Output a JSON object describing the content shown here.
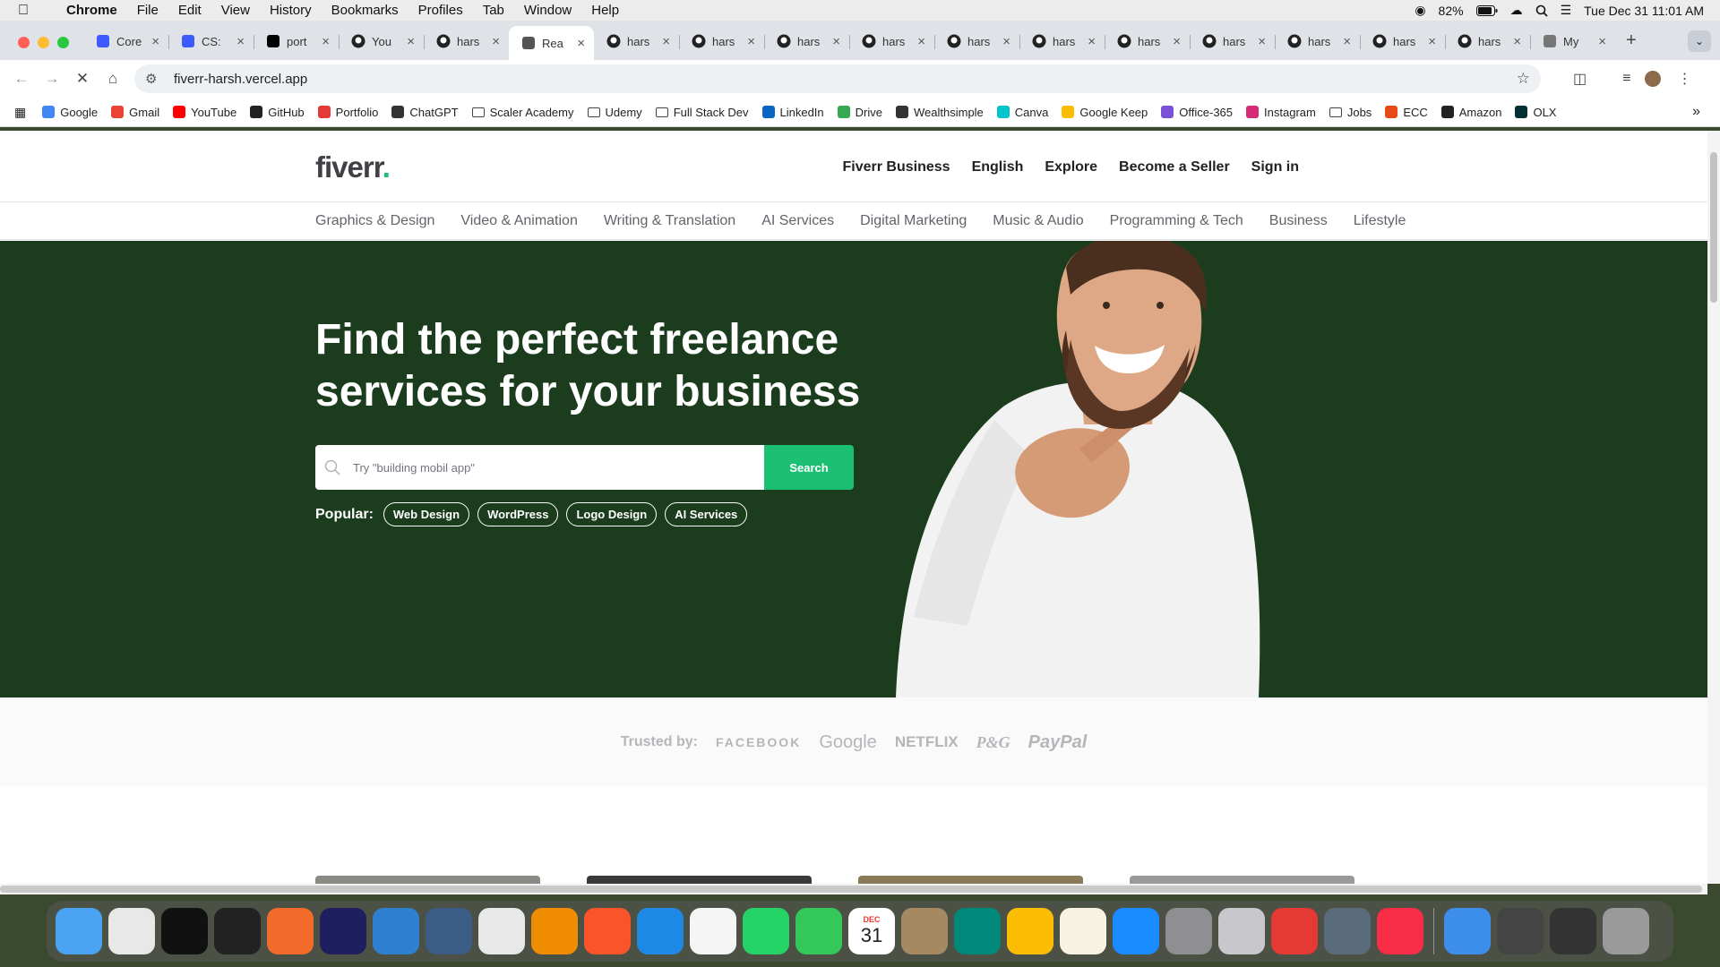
{
  "menubar": {
    "app_name": "Chrome",
    "items": [
      "File",
      "Edit",
      "View",
      "History",
      "Bookmarks",
      "Profiles",
      "Tab",
      "Window",
      "Help"
    ],
    "battery": "82%",
    "datetime": "Tue Dec 31  11:01 AM"
  },
  "tabs": [
    {
      "title": "Core",
      "icon": "cortex-icon",
      "color": "#3d5afe"
    },
    {
      "title": "CS:",
      "icon": "cortex-icon",
      "color": "#3d5afe"
    },
    {
      "title": "port",
      "icon": "vercel-icon",
      "color": "#000000"
    },
    {
      "title": "You",
      "icon": "github-icon",
      "color": "#222222"
    },
    {
      "title": "hars",
      "icon": "github-icon",
      "color": "#222222"
    },
    {
      "title": "Rea",
      "icon": "react-icon",
      "color": "#555555"
    },
    {
      "title": "hars",
      "icon": "github-icon",
      "color": "#222222"
    },
    {
      "title": "hars",
      "icon": "github-icon",
      "color": "#222222"
    },
    {
      "title": "hars",
      "icon": "github-icon",
      "color": "#222222"
    },
    {
      "title": "hars",
      "icon": "github-icon",
      "color": "#222222"
    },
    {
      "title": "hars",
      "icon": "github-icon",
      "color": "#222222"
    },
    {
      "title": "hars",
      "icon": "github-icon",
      "color": "#222222"
    },
    {
      "title": "hars",
      "icon": "github-icon",
      "color": "#222222"
    },
    {
      "title": "hars",
      "icon": "github-icon",
      "color": "#222222"
    },
    {
      "title": "hars",
      "icon": "github-icon",
      "color": "#222222"
    },
    {
      "title": "hars",
      "icon": "github-icon",
      "color": "#222222"
    },
    {
      "title": "hars",
      "icon": "github-icon",
      "color": "#222222"
    },
    {
      "title": "My",
      "icon": "globe-icon",
      "color": "#777777"
    }
  ],
  "active_tab_index": 5,
  "address_bar": {
    "url": "fiverr-harsh.vercel.app"
  },
  "bookmarks": [
    {
      "label": "Google",
      "icon": "google-icon",
      "color": "#4285f4"
    },
    {
      "label": "Gmail",
      "icon": "gmail-icon",
      "color": "#ea4335"
    },
    {
      "label": "YouTube",
      "icon": "youtube-icon",
      "color": "#ff0000"
    },
    {
      "label": "GitHub",
      "icon": "github-icon",
      "color": "#222222"
    },
    {
      "label": "Portfolio",
      "icon": "youtube-icon",
      "color": "#e53935"
    },
    {
      "label": "ChatGPT",
      "icon": "chatgpt-icon",
      "color": "#333333"
    },
    {
      "label": "Scaler Academy",
      "icon": "folder-icon",
      "color": ""
    },
    {
      "label": "Udemy",
      "icon": "folder-icon",
      "color": ""
    },
    {
      "label": "Full Stack Dev",
      "icon": "folder-icon",
      "color": ""
    },
    {
      "label": "LinkedIn",
      "icon": "linkedin-icon",
      "color": "#0a66c2"
    },
    {
      "label": "Drive",
      "icon": "drive-icon",
      "color": "#34a853"
    },
    {
      "label": "Wealthsimple",
      "icon": "wealthsimple-icon",
      "color": "#333333"
    },
    {
      "label": "Canva",
      "icon": "canva-icon",
      "color": "#00c4cc"
    },
    {
      "label": "Google Keep",
      "icon": "keep-icon",
      "color": "#fbbc04"
    },
    {
      "label": "Office-365",
      "icon": "office-icon",
      "color": "#7b4fd6"
    },
    {
      "label": "Instagram",
      "icon": "instagram-icon",
      "color": "#d62976"
    },
    {
      "label": "Jobs",
      "icon": "folder-icon",
      "color": ""
    },
    {
      "label": "ECC",
      "icon": "ecc-icon",
      "color": "#e64a19"
    },
    {
      "label": "Amazon",
      "icon": "amazon-icon",
      "color": "#222222"
    },
    {
      "label": "OLX",
      "icon": "olx-icon",
      "color": "#002f34"
    }
  ],
  "site": {
    "logo_text": "fiverr",
    "logo_dot": ".",
    "brand_green": "#1dbf73",
    "hero_bg": "#1b3c1d",
    "header_links": [
      "Fiverr Business",
      "English",
      "Explore",
      "Become a Seller",
      "Sign in"
    ],
    "categories": [
      "Graphics & Design",
      "Video & Animation",
      "Writing & Translation",
      "AI Services",
      "Digital Marketing",
      "Music & Audio",
      "Programming & Tech",
      "Business",
      "Lifestyle"
    ],
    "hero_title": "Find the perfect freelance services for your business",
    "search_placeholder": "Try \"building mobil app\"",
    "search_button": "Search",
    "popular_label": "Popular:",
    "popular_tags": [
      "Web Design",
      "WordPress",
      "Logo Design",
      "AI Services"
    ],
    "trusted_label": "Trusted by:",
    "trusted_logos": [
      "FACEBOOK",
      "Google",
      "NETFLIX",
      "P&G",
      "PayPal"
    ]
  },
  "dock": {
    "calendar_month": "DEC",
    "calendar_day": "31",
    "apps": [
      {
        "name": "finder-icon",
        "color": "#4aa3f0"
      },
      {
        "name": "launchpad-icon",
        "color": "#e8e8e8"
      },
      {
        "name": "vectorworks-icon",
        "color": "#111111"
      },
      {
        "name": "terminal-icon",
        "color": "#222222"
      },
      {
        "name": "pen-icon",
        "color": "#f26b2a"
      },
      {
        "name": "intellij-icon",
        "color": "#1f1f5f"
      },
      {
        "name": "vscode-icon",
        "color": "#2f80d1"
      },
      {
        "name": "mysql-workbench-icon",
        "color": "#3a5c86"
      },
      {
        "name": "chrome-icon",
        "color": "#e8e8e8"
      },
      {
        "name": "vlc-icon",
        "color": "#f08c00"
      },
      {
        "name": "brave-icon",
        "color": "#fb542b"
      },
      {
        "name": "safari-icon",
        "color": "#1e88e5"
      },
      {
        "name": "photos-icon",
        "color": "#f5f5f5"
      },
      {
        "name": "whatsapp-icon",
        "color": "#25d366"
      },
      {
        "name": "facetime-icon",
        "color": "#34c759"
      },
      {
        "name": "calendar-icon",
        "color": "#ffffff"
      },
      {
        "name": "contacts-icon",
        "color": "#a58a61"
      },
      {
        "name": "meet-icon",
        "color": "#00897b"
      },
      {
        "name": "keep-icon",
        "color": "#fbbc04"
      },
      {
        "name": "notes-icon",
        "color": "#f7f3e0"
      },
      {
        "name": "appstore-icon",
        "color": "#1a8cff"
      },
      {
        "name": "settings-icon",
        "color": "#8e8e93"
      },
      {
        "name": "iphone-mirroring-icon",
        "color": "#c7c7cc"
      },
      {
        "name": "youtube-music-icon",
        "color": "#e53935"
      },
      {
        "name": "preview-icon",
        "color": "#5a6b7c"
      },
      {
        "name": "music-icon",
        "color": "#fa2d48"
      },
      {
        "name": "folder-icon",
        "color": "#3d8eea"
      },
      {
        "name": "screenshot-icon",
        "color": "#444444"
      },
      {
        "name": "recent-window-icon",
        "color": "#333333"
      },
      {
        "name": "trash-icon",
        "color": "#9a9a9a"
      }
    ]
  }
}
